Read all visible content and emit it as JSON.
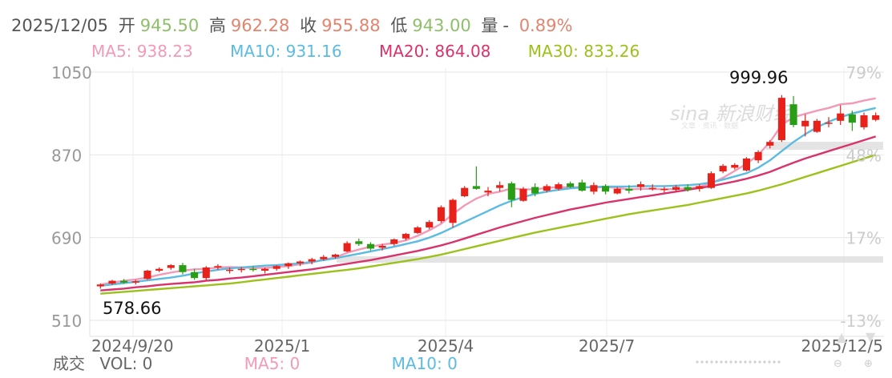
{
  "header": {
    "date": "2025/12/05",
    "open_label": "开",
    "open": "945.50",
    "high_label": "高",
    "high": "962.28",
    "close_label": "收",
    "close": "955.88",
    "low_label": "低",
    "low": "943.00",
    "vol_label": "量",
    "vol": "-",
    "change": "0.89%"
  },
  "ma_legend": {
    "ma5": "MA5: 938.23",
    "ma10": "MA10: 931.16",
    "ma20": "MA20: 864.08",
    "ma30": "MA30: 833.26"
  },
  "volume_row": {
    "label": "成交",
    "vol": "VOL: 0",
    "ma5": "MA5: 0",
    "ma10": "MA10: 0"
  },
  "watermark": "sina 新浪财经",
  "colors": {
    "up": "#e8211a",
    "down": "#2a9d16",
    "ma5": "#f29ab8",
    "ma10": "#5bbbe0",
    "ma20": "#d9336b",
    "ma30": "#9cc11b",
    "grid": "#e6e6e6",
    "axis_text": "#999999",
    "header_gray": "#555555",
    "header_red": "#e3846f",
    "header_green": "#8fbf6a"
  },
  "chart_data": {
    "type": "candlestick",
    "y_axis": {
      "ticks": [
        1050,
        870,
        690,
        510
      ],
      "ylim": [
        510,
        1050
      ]
    },
    "y_axis_right": {
      "ticks": [
        "79%",
        "48%",
        "17%",
        "-13%"
      ]
    },
    "x_axis": {
      "tick_labels": [
        "2024/9/20",
        "2025/1",
        "2025/4",
        "2025/7",
        "2025/12/5"
      ]
    },
    "annotations": {
      "max": "999.96",
      "min": "578.66"
    },
    "grid": true,
    "ohlc": [
      [
        584,
        590,
        579,
        588
      ],
      [
        590,
        598,
        587,
        596
      ],
      [
        596,
        600,
        590,
        592
      ],
      [
        592,
        598,
        588,
        595
      ],
      [
        600,
        620,
        598,
        618
      ],
      [
        618,
        625,
        615,
        622
      ],
      [
        624,
        632,
        620,
        630
      ],
      [
        630,
        635,
        610,
        615
      ],
      [
        615,
        622,
        598,
        602
      ],
      [
        602,
        628,
        598,
        625
      ],
      [
        625,
        632,
        620,
        628
      ],
      [
        618,
        625,
        612,
        620
      ],
      [
        620,
        626,
        614,
        622
      ],
      [
        622,
        628,
        616,
        620
      ],
      [
        618,
        625,
        612,
        622
      ],
      [
        622,
        630,
        618,
        628
      ],
      [
        628,
        636,
        622,
        634
      ],
      [
        634,
        640,
        628,
        638
      ],
      [
        638,
        646,
        632,
        643
      ],
      [
        643,
        652,
        640,
        648
      ],
      [
        648,
        655,
        644,
        653
      ],
      [
        660,
        682,
        658,
        678
      ],
      [
        682,
        688,
        672,
        676
      ],
      [
        676,
        680,
        662,
        666
      ],
      [
        668,
        676,
        662,
        672
      ],
      [
        676,
        688,
        672,
        686
      ],
      [
        688,
        700,
        684,
        698
      ],
      [
        700,
        715,
        698,
        712
      ],
      [
        712,
        728,
        708,
        724
      ],
      [
        726,
        760,
        722,
        756
      ],
      [
        722,
        775,
        712,
        772
      ],
      [
        780,
        802,
        778,
        798
      ],
      [
        802,
        845,
        794,
        796
      ],
      [
        788,
        800,
        780,
        792
      ],
      [
        798,
        812,
        790,
        804
      ],
      [
        808,
        812,
        756,
        772
      ],
      [
        770,
        800,
        768,
        796
      ],
      [
        800,
        808,
        780,
        786
      ],
      [
        792,
        806,
        788,
        802
      ],
      [
        796,
        810,
        792,
        806
      ],
      [
        808,
        812,
        798,
        800
      ],
      [
        810,
        816,
        790,
        792
      ],
      [
        790,
        810,
        784,
        804
      ],
      [
        802,
        806,
        784,
        790
      ],
      [
        786,
        800,
        784,
        796
      ],
      [
        796,
        804,
        786,
        792
      ],
      [
        800,
        812,
        792,
        806
      ],
      [
        796,
        806,
        792,
        798
      ],
      [
        794,
        800,
        788,
        796
      ],
      [
        794,
        804,
        790,
        800
      ],
      [
        800,
        806,
        790,
        794
      ],
      [
        796,
        806,
        790,
        802
      ],
      [
        798,
        834,
        796,
        830
      ],
      [
        834,
        850,
        830,
        846
      ],
      [
        842,
        852,
        838,
        848
      ],
      [
        836,
        865,
        834,
        862
      ],
      [
        858,
        880,
        852,
        876
      ],
      [
        890,
        902,
        884,
        898
      ],
      [
        902,
        1000,
        898,
        994
      ],
      [
        980,
        998,
        930,
        935
      ],
      [
        932,
        958,
        910,
        944
      ],
      [
        920,
        948,
        918,
        944
      ],
      [
        938,
        952,
        930,
        940
      ],
      [
        944,
        978,
        935,
        960
      ],
      [
        958,
        966,
        922,
        940
      ],
      [
        930,
        962,
        925,
        956
      ],
      [
        946,
        962,
        943,
        956
      ]
    ],
    "ma_series": [
      {
        "name": "MA5",
        "values": [
          588,
          592,
          596,
          599,
          603,
          609,
          614,
          618,
          621,
          622,
          625,
          626,
          625,
          624,
          624,
          626,
          628,
          632,
          636,
          642,
          647,
          657,
          664,
          670,
          675,
          678,
          684,
          694,
          706,
          720,
          741,
          760,
          775,
          785,
          790,
          797,
          795,
          795,
          798,
          800,
          799,
          800,
          799,
          800,
          798,
          795,
          796,
          796,
          795,
          796,
          797,
          800,
          808,
          820,
          835,
          850,
          870,
          898,
          935,
          952,
          959,
          966,
          972,
          980,
          982,
          988,
          993
        ]
      },
      {
        "name": "MA10",
        "values": [
          585,
          588,
          591,
          594,
          597,
          600,
          603,
          607,
          612,
          616,
          620,
          623,
          625,
          627,
          629,
          630,
          632,
          634,
          637,
          641,
          645,
          650,
          655,
          660,
          665,
          670,
          676,
          682,
          690,
          700,
          712,
          724,
          736,
          748,
          760,
          770,
          778,
          785,
          790,
          794,
          797,
          799,
          800,
          801,
          801,
          801,
          802,
          802,
          802,
          803,
          804,
          806,
          810,
          816,
          823,
          830,
          842,
          858,
          878,
          898,
          915,
          930,
          942,
          952,
          960,
          966,
          972
        ]
      },
      {
        "name": "MA20",
        "values": [
          575,
          577,
          579,
          582,
          584,
          587,
          589,
          591,
          593,
          596,
          598,
          601,
          603,
          606,
          609,
          612,
          615,
          618,
          621,
          625,
          629,
          633,
          637,
          641,
          646,
          651,
          656,
          661,
          667,
          673,
          680,
          688,
          696,
          704,
          712,
          719,
          726,
          733,
          739,
          745,
          751,
          756,
          761,
          766,
          770,
          774,
          778,
          782,
          786,
          790,
          794,
          798,
          802,
          807,
          812,
          818,
          825,
          833,
          843,
          853,
          862,
          870,
          878,
          886,
          894,
          902,
          910
        ]
      },
      {
        "name": "MA30",
        "values": [
          568,
          570,
          572,
          574,
          576,
          578,
          580,
          582,
          584,
          586,
          588,
          590,
          593,
          596,
          599,
          602,
          605,
          608,
          611,
          614,
          617,
          620,
          623,
          627,
          631,
          635,
          639,
          643,
          648,
          653,
          659,
          665,
          671,
          677,
          683,
          689,
          695,
          701,
          706,
          711,
          716,
          721,
          726,
          731,
          736,
          741,
          745,
          749,
          753,
          757,
          761,
          766,
          771,
          776,
          781,
          786,
          792,
          799,
          806,
          814,
          822,
          830,
          838,
          846,
          854,
          862,
          870
        ]
      }
    ]
  }
}
